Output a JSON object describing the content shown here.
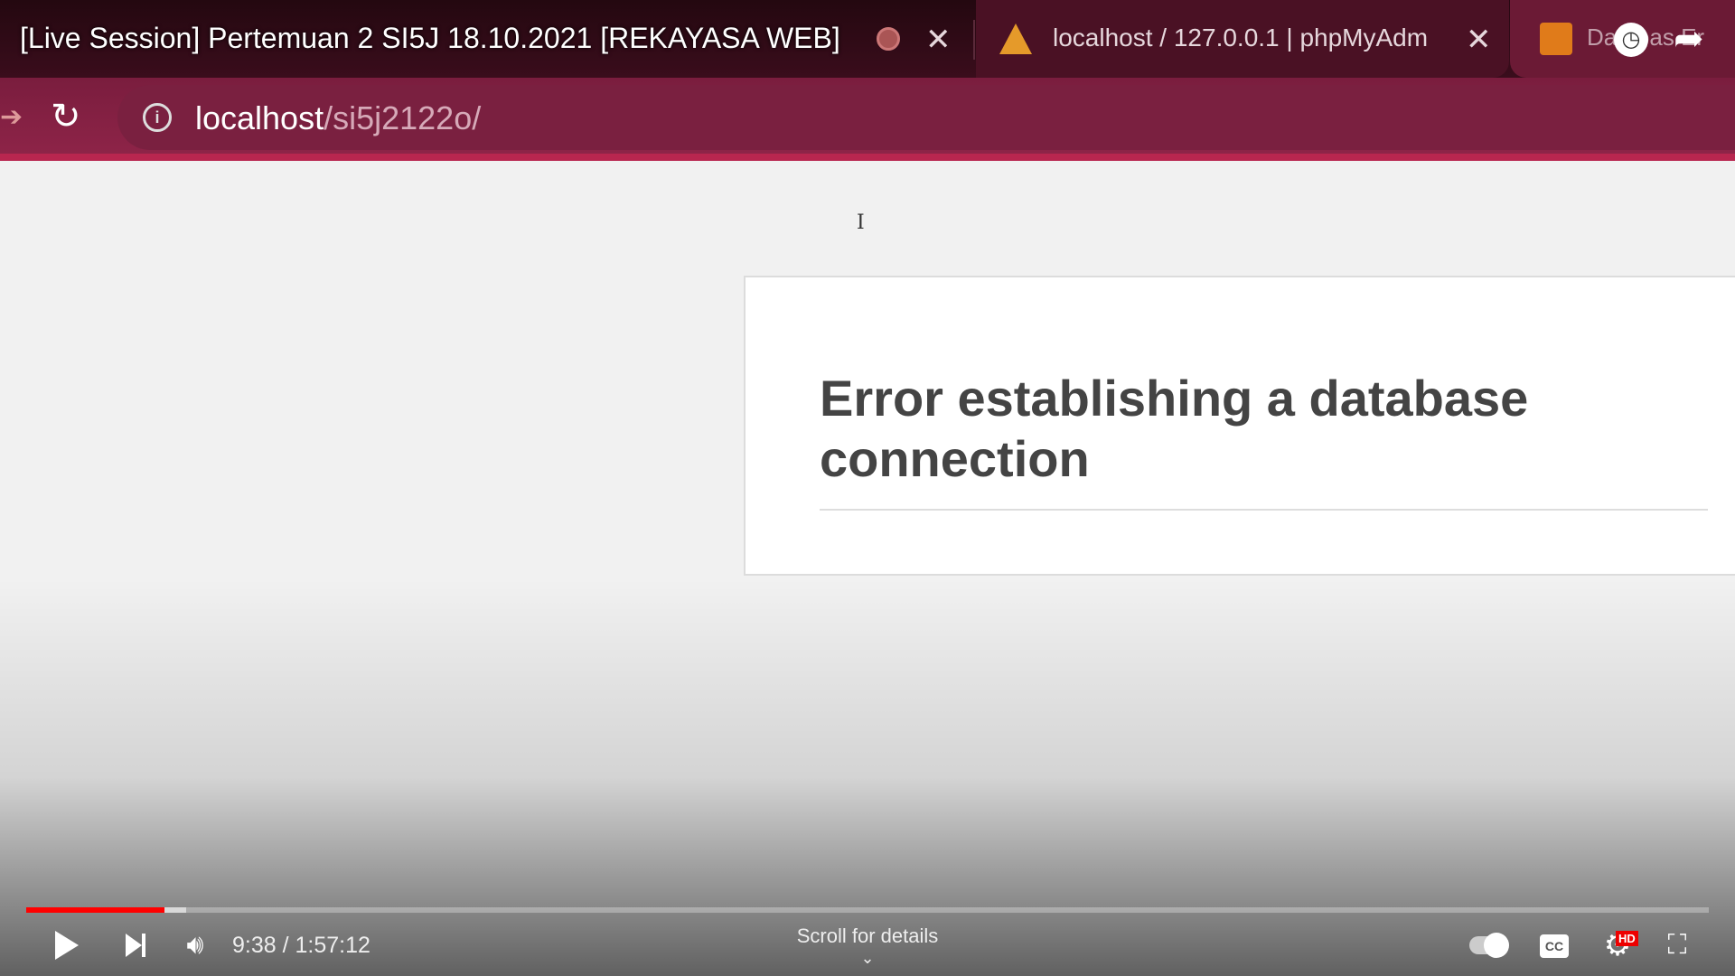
{
  "video": {
    "title": "[Live Session] Pertemuan 2 SI5J 18.10.2021 [REKAYASA WEB]",
    "time_current": "9:38",
    "time_total": "1:57:12",
    "time_sep": " / ",
    "scroll_hint": "Scroll for details",
    "progress_played_pct": 8.2,
    "progress_buffered_pct": 9.5,
    "hd_badge": "HD",
    "accent": "#ff0000"
  },
  "browser": {
    "tabs": [
      {
        "label": "localhost / 127.0.0.1 | phpMyAdm",
        "icon": "phpmyadmin-icon"
      },
      {
        "label": "Databas Er",
        "icon": "xampp-icon"
      }
    ],
    "url_host": "localhost",
    "url_path": "/si5j2122o/"
  },
  "page": {
    "error_heading": "Error establishing a database connection"
  }
}
